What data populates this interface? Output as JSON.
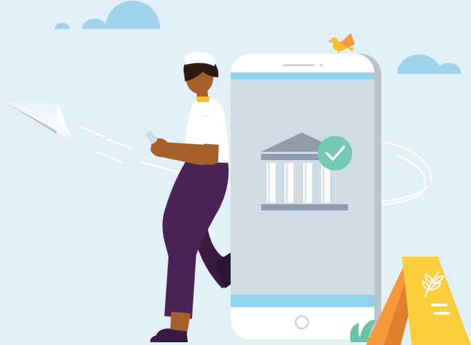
{
  "illustration": {
    "background_color": "#e2f0f7",
    "cloud_color": "#9fd3ec",
    "phone_body_color": "#ffffff",
    "phone_screen_color": "#cfdce6",
    "phone_accent_bar_color": "#8fd4ef",
    "bank_icon_color": "#8e9cab",
    "check_badge_color": "#74c9b2",
    "bird_color": "#f7bf2e",
    "sign_orange": "#f59a3a",
    "sign_yellow": "#fbcd3b",
    "plant_color": "#6cc4a4",
    "figure_shirt_color": "#ffffff",
    "figure_pants_color": "#4a2457",
    "figure_skin_color": "#a8602a",
    "figure_hair_color": "#2e1a12",
    "icons": [
      "paper-plane-icon",
      "bank-icon",
      "checkmark-icon",
      "bird-icon",
      "wheat-icon",
      "home-button-icon"
    ]
  }
}
